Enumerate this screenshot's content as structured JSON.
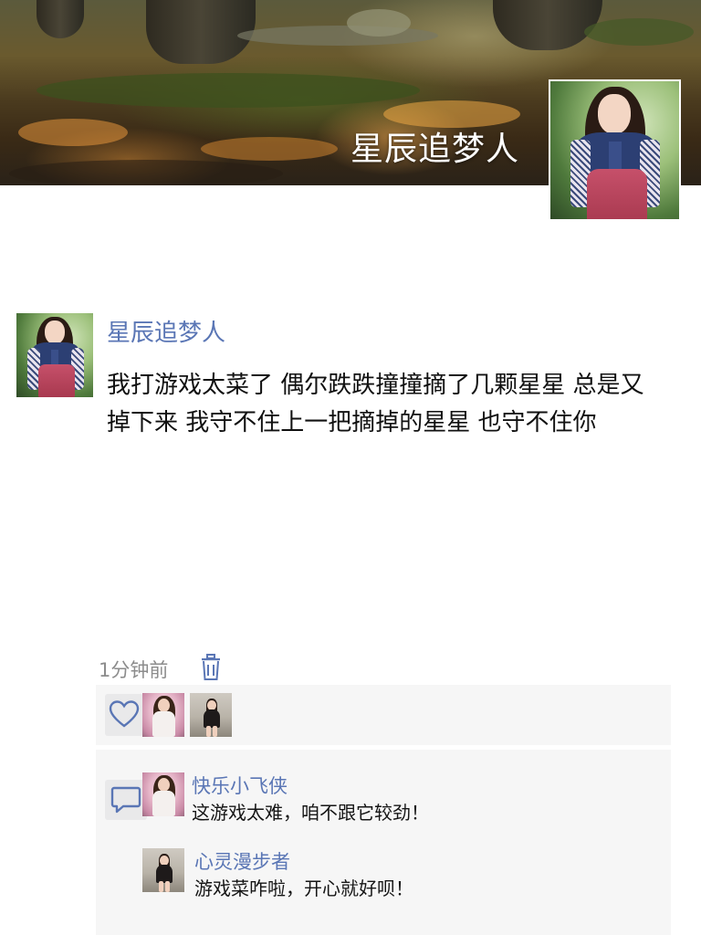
{
  "profile": {
    "cover_title": "星辰追梦人"
  },
  "post": {
    "author": "星辰追梦人",
    "text": "我打游戏太菜了 偶尔跌跌撞撞摘了几颗星星 总是又掉下来 我守不住上一把摘掉的星星 也守不住你",
    "time": "1分钟前"
  },
  "comments": [
    {
      "author": "快乐小飞侠",
      "text": "这游戏太难，咱不跟它较劲！"
    },
    {
      "author": "心灵漫步者",
      "text": "游戏菜咋啦，开心就好呗！"
    }
  ],
  "icons": {
    "delete": "trash-icon",
    "like": "heart-icon",
    "comment": "comment-icon"
  },
  "colors": {
    "name_link": "#5a76b5",
    "panel_bg": "#f6f6f6"
  }
}
